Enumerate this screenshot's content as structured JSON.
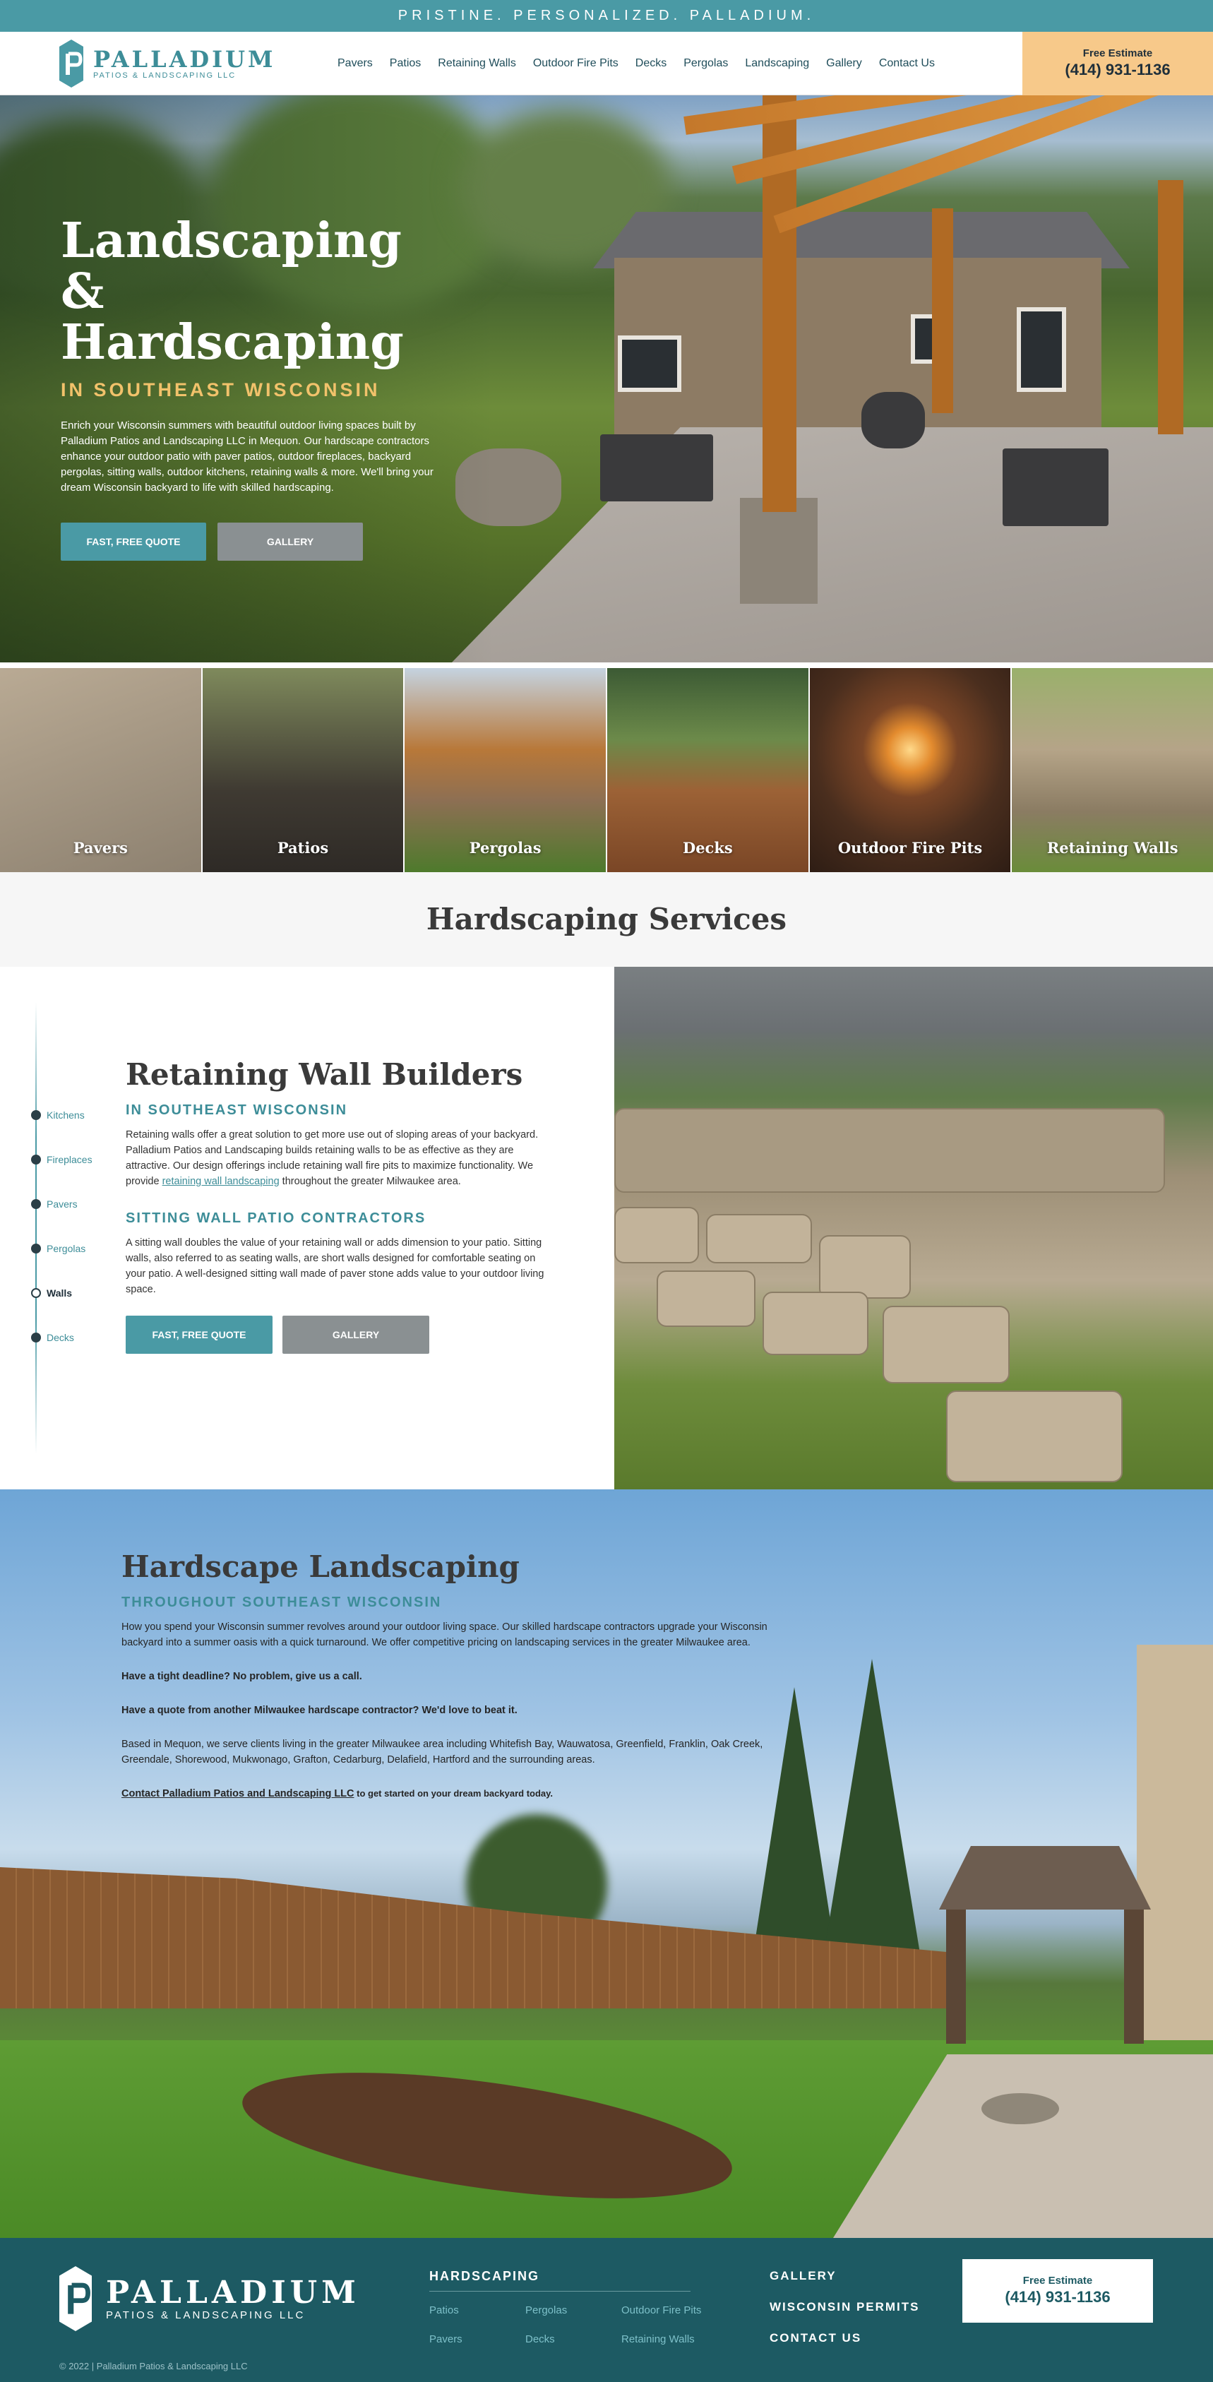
{
  "topbar": {
    "tagline": "PRISTINE. PERSONALIZED. PALLADIUM."
  },
  "header": {
    "logo_name": "PALLADIUM",
    "logo_sub": "PATIOS & LANDSCAPING LLC",
    "nav": [
      "Pavers",
      "Patios",
      "Retaining Walls",
      "Outdoor Fire Pits",
      "Decks",
      "Pergolas",
      "Landscaping",
      "Gallery",
      "Contact Us"
    ],
    "estimate_label": "Free Estimate",
    "estimate_phone": "(414) 931-1136"
  },
  "hero": {
    "title_line1": "Landscaping",
    "title_line2": "& Hardscaping",
    "subtitle": "IN SOUTHEAST WISCONSIN",
    "description": "Enrich your Wisconsin summers with beautiful outdoor living spaces built by Palladium Patios and Landscaping LLC in Mequon. Our hardscape contractors enhance your outdoor patio with paver patios, outdoor fireplaces, backyard pergolas, sitting walls, outdoor kitchens, retaining walls & more. We'll bring your dream Wisconsin backyard to life with skilled hardscaping.",
    "btn_quote": "FAST, FREE QUOTE",
    "btn_gallery": "GALLERY"
  },
  "tiles": [
    "Pavers",
    "Patios",
    "Pergolas",
    "Decks",
    "Outdoor Fire Pits",
    "Retaining Walls"
  ],
  "services": {
    "title": "Hardscaping Services"
  },
  "retaining": {
    "timeline": [
      "Kitchens",
      "Fireplaces",
      "Pavers",
      "Pergolas",
      "Walls",
      "Decks"
    ],
    "title": "Retaining Wall Builders",
    "subtitle1": "IN SOUTHEAST WISCONSIN",
    "para1_a": "Retaining walls offer a great solution to get more use out of sloping areas of your backyard. Palladium Patios and Landscaping builds retaining walls to be as effective as they are attractive. Our design offerings include retaining wall fire pits to maximize functionality. We provide ",
    "para1_link": "retaining wall landscaping",
    "para1_b": " throughout the greater Milwaukee area.",
    "subtitle2": "SITTING WALL PATIO CONTRACTORS",
    "para2": "A sitting wall doubles the value of your retaining wall or adds dimension to your patio. Sitting walls, also referred to as seating walls, are short walls designed for comfortable seating on your patio. A well-designed sitting wall made of paver stone adds value to your outdoor living space.",
    "btn_quote": "FAST, FREE QUOTE",
    "btn_gallery": "GALLERY"
  },
  "landscaping": {
    "title": "Hardscape Landscaping",
    "subtitle": "THROUGHOUT SOUTHEAST WISCONSIN",
    "para1": "How you spend your Wisconsin summer revolves around your outdoor living space. Our skilled hardscape contractors upgrade your Wisconsin backyard into a summer oasis with a quick turnaround. We offer competitive pricing on landscaping services in the greater Milwaukee area.",
    "para2": "Have a tight deadline? No problem, give us a call.",
    "para3": "Have a quote from another Milwaukee hardscape contractor? We'd love to beat it.",
    "para4": "Based in Mequon, we serve clients living in the greater Milwaukee area including Whitefish Bay, Wauwatosa, Greenfield, Franklin, Oak Creek, Greendale, Shorewood, Mukwonago, Grafton, Cedarburg, Delafield, Hartford and the surrounding areas.",
    "contact_link": "Contact Palladium Patios and Landscaping LLC",
    "contact_rest": " to get started on your dream backyard today."
  },
  "footer": {
    "logo_name": "PALLADIUM",
    "logo_sub": "PATIOS & LANDSCAPING LLC",
    "col_title": "HARDSCAPING",
    "col_links": [
      "Patios",
      "Pergolas",
      "Outdoor Fire Pits",
      "Pavers",
      "Decks",
      "Retaining Walls"
    ],
    "links": [
      "GALLERY",
      "WISCONSIN PERMITS",
      "CONTACT US"
    ],
    "estimate_label": "Free Estimate",
    "estimate_phone": "(414) 931-1136",
    "copyright": "© 2022 | Palladium Patios & Landscaping LLC"
  },
  "colors": {
    "teal": "#4a9aa5",
    "gold": "#f7c98a",
    "footer": "#1d5a63"
  }
}
